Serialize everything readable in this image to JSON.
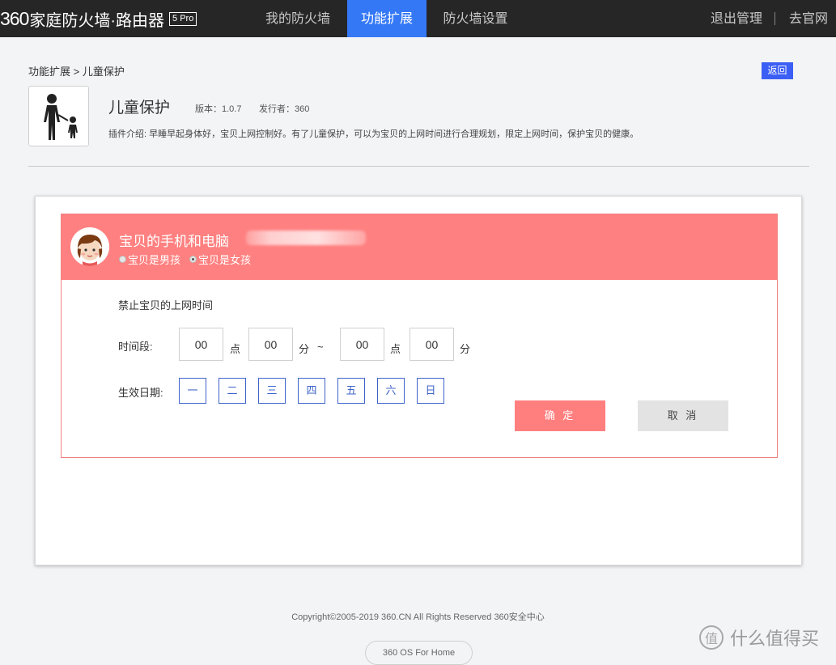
{
  "header": {
    "logo_num": "360",
    "logo_text": "家庭防火墙·路由器",
    "logo_badge": "5 Pro",
    "tabs": [
      {
        "label": "我的防火墙",
        "active": false
      },
      {
        "label": "功能扩展",
        "active": true
      },
      {
        "label": "防火墙设置",
        "active": false
      }
    ],
    "logout": "退出管理",
    "official_site": "去官网"
  },
  "breadcrumb": "功能扩展 > 儿童保护",
  "back_label": "返回",
  "plugin": {
    "name": "儿童保护",
    "version": "版本：1.0.7",
    "publisher": "发行者：360",
    "intro": "插件介绍:  早睡早起身体好，宝贝上网控制好。有了儿童保护，可以为宝贝的上网时间进行合理规划，限定上网时间，保护宝贝的健康。"
  },
  "device": {
    "title": "宝贝的手机和电脑",
    "gender_boy": "宝贝是男孩",
    "gender_girl": "宝贝是女孩",
    "selected_gender": "girl"
  },
  "form": {
    "section_label": "禁止宝贝的上网时间",
    "time_label": "时间段:",
    "start_hour": "00",
    "start_min": "00",
    "end_hour": "00",
    "end_min": "00",
    "unit_hour": "点",
    "unit_min": "分",
    "range_sep": "~",
    "days_label": "生效日期:",
    "days": [
      "一",
      "二",
      "三",
      "四",
      "五",
      "六",
      "日"
    ],
    "confirm": "确 定",
    "cancel": "取 消"
  },
  "footer": {
    "copyright": "Copyright©2005-2019 360.CN All Rights Reserved 360安全中心",
    "os": "360 OS For Home"
  },
  "watermark": {
    "icon": "值",
    "text": "什么值得买"
  },
  "colors": {
    "accent": "#3478f6",
    "topbar": "#262626",
    "card_header": "#ff8080",
    "confirm": "#ff7f7f",
    "day_border": "#3d63c9"
  }
}
